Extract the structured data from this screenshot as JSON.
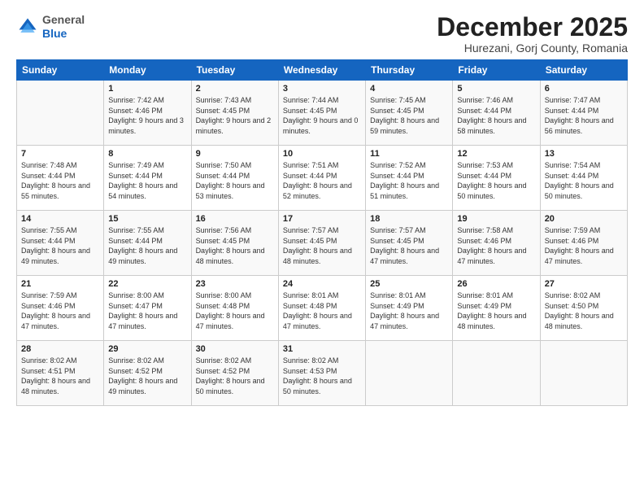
{
  "header": {
    "logo": {
      "line1": "General",
      "line2": "Blue"
    },
    "title": "December 2025",
    "location": "Hurezani, Gorj County, Romania"
  },
  "weekdays": [
    "Sunday",
    "Monday",
    "Tuesday",
    "Wednesday",
    "Thursday",
    "Friday",
    "Saturday"
  ],
  "weeks": [
    [
      {
        "day": "",
        "sunrise": "",
        "sunset": "",
        "daylight": ""
      },
      {
        "day": "1",
        "sunrise": "7:42 AM",
        "sunset": "4:46 PM",
        "daylight": "9 hours and 3 minutes."
      },
      {
        "day": "2",
        "sunrise": "7:43 AM",
        "sunset": "4:45 PM",
        "daylight": "9 hours and 2 minutes."
      },
      {
        "day": "3",
        "sunrise": "7:44 AM",
        "sunset": "4:45 PM",
        "daylight": "9 hours and 0 minutes."
      },
      {
        "day": "4",
        "sunrise": "7:45 AM",
        "sunset": "4:45 PM",
        "daylight": "8 hours and 59 minutes."
      },
      {
        "day": "5",
        "sunrise": "7:46 AM",
        "sunset": "4:44 PM",
        "daylight": "8 hours and 58 minutes."
      },
      {
        "day": "6",
        "sunrise": "7:47 AM",
        "sunset": "4:44 PM",
        "daylight": "8 hours and 56 minutes."
      }
    ],
    [
      {
        "day": "7",
        "sunrise": "7:48 AM",
        "sunset": "4:44 PM",
        "daylight": "8 hours and 55 minutes."
      },
      {
        "day": "8",
        "sunrise": "7:49 AM",
        "sunset": "4:44 PM",
        "daylight": "8 hours and 54 minutes."
      },
      {
        "day": "9",
        "sunrise": "7:50 AM",
        "sunset": "4:44 PM",
        "daylight": "8 hours and 53 minutes."
      },
      {
        "day": "10",
        "sunrise": "7:51 AM",
        "sunset": "4:44 PM",
        "daylight": "8 hours and 52 minutes."
      },
      {
        "day": "11",
        "sunrise": "7:52 AM",
        "sunset": "4:44 PM",
        "daylight": "8 hours and 51 minutes."
      },
      {
        "day": "12",
        "sunrise": "7:53 AM",
        "sunset": "4:44 PM",
        "daylight": "8 hours and 50 minutes."
      },
      {
        "day": "13",
        "sunrise": "7:54 AM",
        "sunset": "4:44 PM",
        "daylight": "8 hours and 50 minutes."
      }
    ],
    [
      {
        "day": "14",
        "sunrise": "7:55 AM",
        "sunset": "4:44 PM",
        "daylight": "8 hours and 49 minutes."
      },
      {
        "day": "15",
        "sunrise": "7:55 AM",
        "sunset": "4:44 PM",
        "daylight": "8 hours and 49 minutes."
      },
      {
        "day": "16",
        "sunrise": "7:56 AM",
        "sunset": "4:45 PM",
        "daylight": "8 hours and 48 minutes."
      },
      {
        "day": "17",
        "sunrise": "7:57 AM",
        "sunset": "4:45 PM",
        "daylight": "8 hours and 48 minutes."
      },
      {
        "day": "18",
        "sunrise": "7:57 AM",
        "sunset": "4:45 PM",
        "daylight": "8 hours and 47 minutes."
      },
      {
        "day": "19",
        "sunrise": "7:58 AM",
        "sunset": "4:46 PM",
        "daylight": "8 hours and 47 minutes."
      },
      {
        "day": "20",
        "sunrise": "7:59 AM",
        "sunset": "4:46 PM",
        "daylight": "8 hours and 47 minutes."
      }
    ],
    [
      {
        "day": "21",
        "sunrise": "7:59 AM",
        "sunset": "4:46 PM",
        "daylight": "8 hours and 47 minutes."
      },
      {
        "day": "22",
        "sunrise": "8:00 AM",
        "sunset": "4:47 PM",
        "daylight": "8 hours and 47 minutes."
      },
      {
        "day": "23",
        "sunrise": "8:00 AM",
        "sunset": "4:48 PM",
        "daylight": "8 hours and 47 minutes."
      },
      {
        "day": "24",
        "sunrise": "8:01 AM",
        "sunset": "4:48 PM",
        "daylight": "8 hours and 47 minutes."
      },
      {
        "day": "25",
        "sunrise": "8:01 AM",
        "sunset": "4:49 PM",
        "daylight": "8 hours and 47 minutes."
      },
      {
        "day": "26",
        "sunrise": "8:01 AM",
        "sunset": "4:49 PM",
        "daylight": "8 hours and 48 minutes."
      },
      {
        "day": "27",
        "sunrise": "8:02 AM",
        "sunset": "4:50 PM",
        "daylight": "8 hours and 48 minutes."
      }
    ],
    [
      {
        "day": "28",
        "sunrise": "8:02 AM",
        "sunset": "4:51 PM",
        "daylight": "8 hours and 48 minutes."
      },
      {
        "day": "29",
        "sunrise": "8:02 AM",
        "sunset": "4:52 PM",
        "daylight": "8 hours and 49 minutes."
      },
      {
        "day": "30",
        "sunrise": "8:02 AM",
        "sunset": "4:52 PM",
        "daylight": "8 hours and 50 minutes."
      },
      {
        "day": "31",
        "sunrise": "8:02 AM",
        "sunset": "4:53 PM",
        "daylight": "8 hours and 50 minutes."
      },
      {
        "day": "",
        "sunrise": "",
        "sunset": "",
        "daylight": ""
      },
      {
        "day": "",
        "sunrise": "",
        "sunset": "",
        "daylight": ""
      },
      {
        "day": "",
        "sunrise": "",
        "sunset": "",
        "daylight": ""
      }
    ]
  ]
}
